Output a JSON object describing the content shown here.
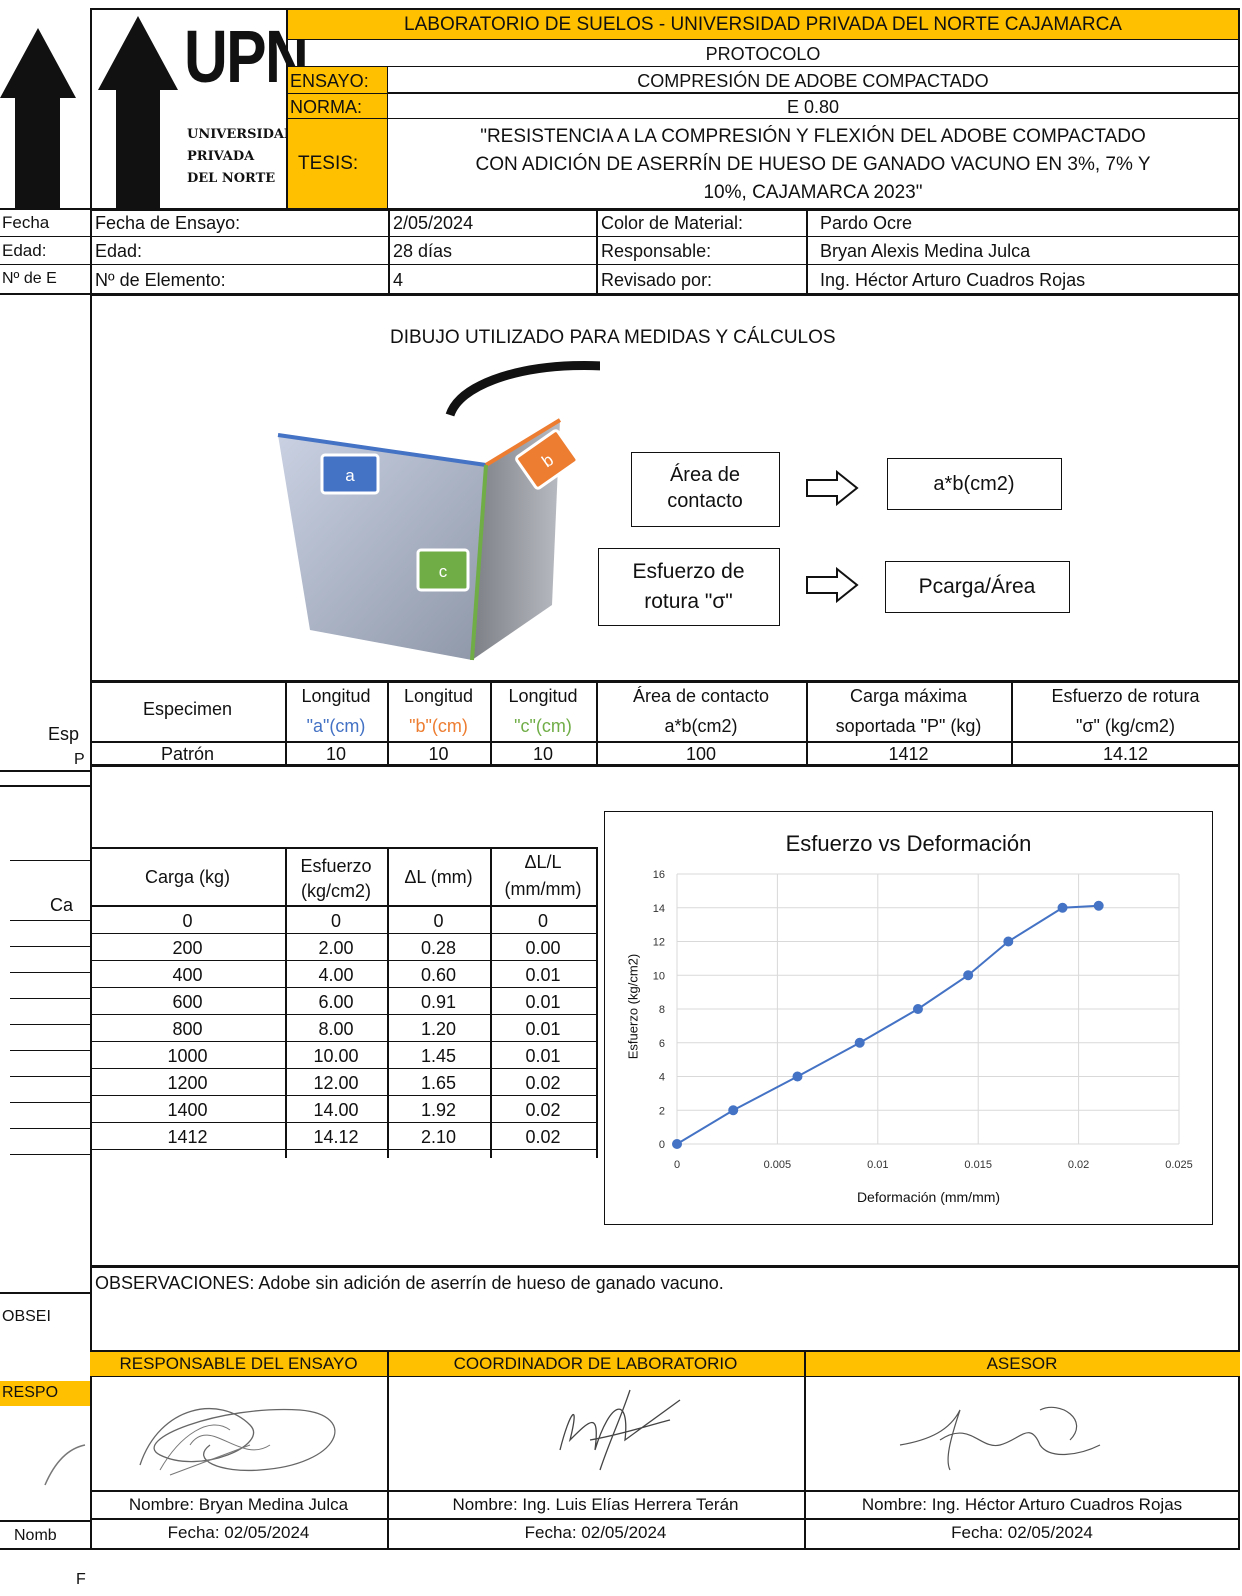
{
  "header": {
    "lab": "LABORATORIO DE SUELOS - UNIVERSIDAD PRIVADA DEL NORTE CAJAMARCA",
    "protocolo": "PROTOCOLO",
    "ensayo_label": "ENSAYO:",
    "ensayo_value": "COMPRESIÓN DE ADOBE COMPACTADO",
    "norma_label": "NORMA:",
    "norma_value": "E 0.80",
    "tesis_label": "TESIS:",
    "tesis_line1": "\"RESISTENCIA A LA COMPRESIÓN Y FLEXIÓN DEL ADOBE COMPACTADO",
    "tesis_line2": "CON ADICIÓN DE ASERRÍN DE HUESO DE GANADO VACUNO EN 3%, 7% Y",
    "tesis_line3": "10%, CAJAMARCA 2023\""
  },
  "logo": {
    "text": "UPN",
    "sub1": "UNIVERSIDAD",
    "sub2": "PRIVADA",
    "sub3": "DEL NORTE"
  },
  "left_strip": {
    "fecha": "Fecha",
    "edad": "Edad:",
    "elemento": "Nº de E",
    "esp": "Esp",
    "p": "P",
    "ca": "Ca",
    "obse": "OBSEI",
    "resp": "RESPO",
    "nomb": "Nomb",
    "f": "F"
  },
  "info": {
    "fecha_label": "Fecha de Ensayo:",
    "fecha_value": "2/05/2024",
    "color_label": "Color de Material:",
    "color_value": "Pardo Ocre",
    "edad_label": "Edad:",
    "edad_value": "28 días",
    "resp_label": "Responsable:",
    "resp_value": "Bryan Alexis Medina Julca",
    "elem_label": "Nº de Elemento:",
    "elem_value": "4",
    "rev_label": "Revisado por:",
    "rev_value": "Ing. Héctor Arturo Cuadros Rojas"
  },
  "diagram": {
    "title": "DIBUJO UTILIZADO PARA MEDIDAS Y CÁLCULOS",
    "label_a": "a",
    "label_b": "b",
    "label_c": "c",
    "area_line1": "Área de",
    "area_line2": "contacto",
    "area_formula": "a*b(cm2)",
    "esf_line1": "Esfuerzo de",
    "esf_line2": "rotura \"σ\"",
    "esf_formula": "Pcarga/Área",
    "colors": {
      "a": "#4472c4",
      "b": "#ed7d31",
      "c": "#70ad47"
    }
  },
  "spec_table": {
    "h1": "Especimen",
    "h2a": "Longitud",
    "h2b": "\"a\"(cm)",
    "h3a": "Longitud",
    "h3b": "\"b\"(cm)",
    "h4a": "Longitud",
    "h4b": "\"c\"(cm)",
    "h5a": "Área de contacto",
    "h5b": "a*b(cm2)",
    "h6a": "Carga máxima",
    "h6b": "soportada \"P\" (kg)",
    "h7a": "Esfuerzo de rotura",
    "h7b": "\"σ\" (kg/cm2)",
    "row": [
      "Patrón",
      "10",
      "10",
      "10",
      "100",
      "1412",
      "14.12"
    ]
  },
  "load_table": {
    "h1": "Carga (kg)",
    "h2a": "Esfuerzo",
    "h2b": "(kg/cm2)",
    "h3": "ΔL (mm)",
    "h4a": "ΔL/L",
    "h4b": "(mm/mm)",
    "rows": [
      [
        "0",
        "0",
        "0",
        "0"
      ],
      [
        "200",
        "2.00",
        "0.28",
        "0.00"
      ],
      [
        "400",
        "4.00",
        "0.60",
        "0.01"
      ],
      [
        "600",
        "6.00",
        "0.91",
        "0.01"
      ],
      [
        "800",
        "8.00",
        "1.20",
        "0.01"
      ],
      [
        "1000",
        "10.00",
        "1.45",
        "0.01"
      ],
      [
        "1200",
        "12.00",
        "1.65",
        "0.02"
      ],
      [
        "1400",
        "14.00",
        "1.92",
        "0.02"
      ],
      [
        "1412",
        "14.12",
        "2.10",
        "0.02"
      ]
    ]
  },
  "chart_data": {
    "type": "line",
    "title": "Esfuerzo vs Deformación",
    "xlabel": "Deformación (mm/mm)",
    "ylabel": "Esfuerzo (kg/cm2)",
    "xlim": [
      0,
      0.025
    ],
    "ylim": [
      0,
      16
    ],
    "xticks": [
      "0",
      "0.005",
      "0.01",
      "0.015",
      "0.02",
      "0.025"
    ],
    "yticks": [
      "0",
      "2",
      "4",
      "6",
      "8",
      "10",
      "12",
      "14",
      "16"
    ],
    "grid": true,
    "color": "#4472c4",
    "x": [
      0,
      0.0028,
      0.006,
      0.0091,
      0.012,
      0.0145,
      0.0165,
      0.0192,
      0.021
    ],
    "y": [
      0,
      2,
      4,
      6,
      8,
      10,
      12,
      14,
      14.12
    ]
  },
  "observ": "OBSERVACIONES: Adobe sin adición de aserrín de hueso de ganado vacuno.",
  "signatures": {
    "h1": "RESPONSABLE DEL ENSAYO",
    "h2": "COORDINADOR DE LABORATORIO",
    "h3": "ASESOR",
    "n1": "Nombre: Bryan Medina Julca",
    "n2": "Nombre: Ing. Luis Elías Herrera Terán",
    "n3": "Nombre: Ing. Héctor Arturo Cuadros Rojas",
    "f1": "Fecha: 02/05/2024",
    "f2": "Fecha: 02/05/2024",
    "f3": "Fecha: 02/05/2024"
  }
}
